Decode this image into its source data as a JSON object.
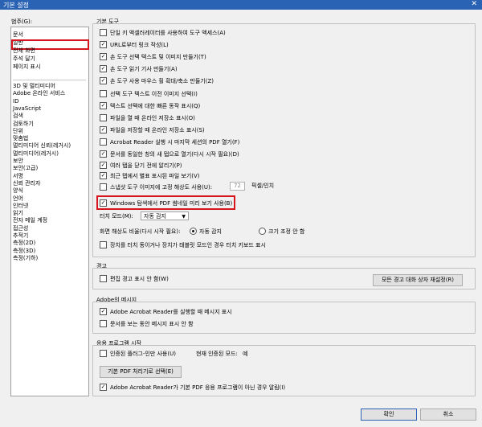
{
  "window": {
    "title": "기본 설정",
    "close": "✕"
  },
  "sidebar": {
    "label": "범주(G):",
    "top_items": [
      "문서",
      "일반",
      "전체 화면",
      "주석 달기",
      "페이지 표시"
    ],
    "items": [
      "3D 및 멀티미디어",
      "Adobe 온라인 서비스",
      "ID",
      "JavaScript",
      "검색",
      "검토하기",
      "단위",
      "맞춤법",
      "멀티미디어 신뢰(레거시)",
      "멀티미디어(레거시)",
      "보안",
      "보안(고급)",
      "서명",
      "신뢰 관리자",
      "양식",
      "언어",
      "인터넷",
      "읽기",
      "전자 메일 계정",
      "접근성",
      "추적기",
      "측정(2D)",
      "측정(3D)",
      "측정(기하)"
    ],
    "selected": "일반"
  },
  "basic_tools": {
    "title": "기본 도구",
    "items": [
      {
        "label": "단일 키 액셀러레이터를 사용하여 도구 액세스(A)",
        "checked": false
      },
      {
        "label": "URL로부터 링크 작성(L)",
        "checked": true
      },
      {
        "label": "손 도구 선택 텍스트 및 이미지 만들기(T)",
        "checked": true
      },
      {
        "label": "손 도구 읽기 기사 만들기(A)",
        "checked": true
      },
      {
        "label": "손 도구 사용 마우스 휠 확대/축소 만들기(Z)",
        "checked": true
      },
      {
        "label": "선택 도구 텍스트 이전 이미지 선택(I)",
        "checked": false
      },
      {
        "label": "텍스트 선택에 대한 빠른 동작 표시(Q)",
        "checked": true
      },
      {
        "label": "파일을 열 때 온라인 저장소 표시(O)",
        "checked": false
      },
      {
        "label": "파일을 저장할 때 온라인 저장소 표시(S)",
        "checked": true
      },
      {
        "label": "Acrobat Reader 실행 시 마지막 세션의 PDF 열기(F)",
        "checked": false
      },
      {
        "label": "문서를 동일한 창의 새 탭으로 열기(다시 시작 필요)(D)",
        "checked": true
      },
      {
        "label": "여러 탭을 닫기 전에 알리기(P)",
        "checked": true
      },
      {
        "label": "최근 탭에서 별표 표시된 파일 보기(V)",
        "checked": true
      },
      {
        "label": "스냅샷 도구 이미지에 고정 해상도 사용(U):",
        "checked": false
      },
      {
        "label": "Windows 탐색에서 PDF 썸네일 미리 보기 사용(B)",
        "checked": true
      }
    ],
    "resolution_value": "72",
    "resolution_unit": "픽셀/인치",
    "touch_mode_label": "터치 모드(M):",
    "touch_mode_value": "자동 감지",
    "screen_res_label": "화면 해상도 비율(다시 시작 필요):",
    "radio_auto": "자동 감지",
    "radio_custom": "크기 조정 안 함",
    "touch_keyboard": "장치를 터치 동이거나 장치가 태블릿 모드인 경우 터치 키보드 표시"
  },
  "warnings": {
    "title": "경고",
    "edit_warning": "편집 경고 표시 안 함(W)",
    "reset_button": "모든 경고 대화 상자 재설정(R)"
  },
  "adobe_messages": {
    "title": "Adobe의 메시지",
    "on_launch": "Adobe Acrobat Reader를 실행할 때 메시지 표시",
    "while_viewing": "문서를 보는 동안 메시지 표시 안 함"
  },
  "app_startup": {
    "title": "응용 프로그램 시작",
    "protected_mode": "인증된 플러그-인만 사용(U)",
    "current_mode_label": "현재 인증된 모드:",
    "current_mode_value": "예",
    "default_handler_button": "기본 PDF 처리기로 선택(E)",
    "not_default_prompt": "Adobe Acrobat Reader가 기본 PDF 응용 프로그램이 아닌 경우 알림(I)"
  },
  "footer": {
    "ok": "확인",
    "cancel": "취소"
  }
}
